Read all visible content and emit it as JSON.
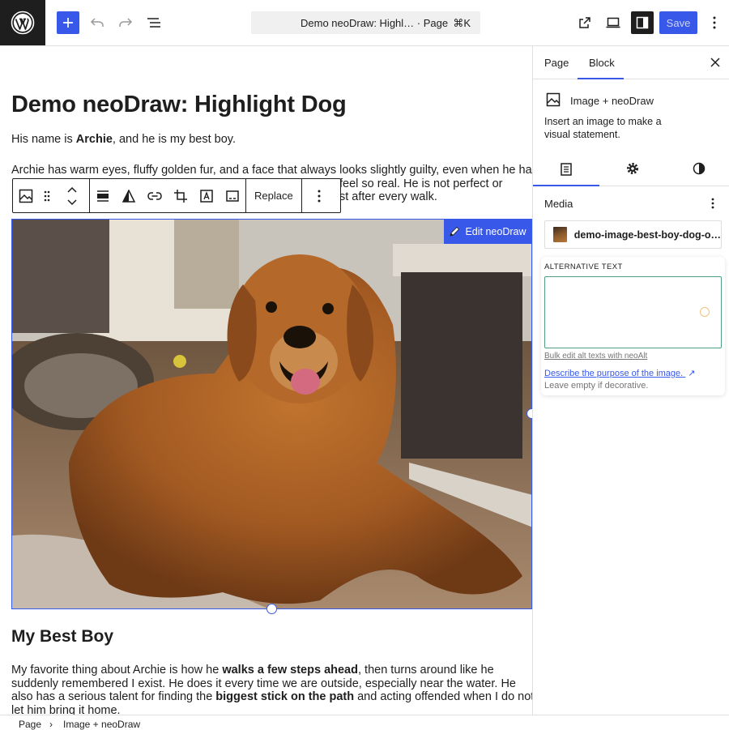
{
  "header": {
    "document_title": "Demo neoDraw: Highl… · Page",
    "shortcut": "⌘K",
    "save_label": "Save"
  },
  "colors": {
    "accent": "#3858e9",
    "dark": "#1e1e1e",
    "alt_focus": "#4f9d83"
  },
  "icons": [
    "wordpress-logo-icon",
    "plus-icon",
    "undo-icon",
    "redo-icon",
    "document-overview-icon",
    "external-link-icon",
    "device-preview-icon",
    "sidebar-toggle-icon",
    "more-vertical-icon"
  ],
  "content": {
    "title": "Demo neoDraw: Highlight Dog",
    "p1_a": "His name is ",
    "p1_b": "Archie",
    "p1_c": ", and he is my best boy.",
    "p2_line1": "Archie has warm eyes, fluffy golden fur, and a face that always looks slightly guilty, even when he has",
    "p2_line2_tail": "feel so real. He is not perfect or",
    "p2_line3_tail": "st after every walk.",
    "heading2": "My Best Boy",
    "p3_a": "My favorite thing about Archie is how he ",
    "p3_b": "walks a few steps ahead",
    "p3_c": ", then turns around like he suddenly remembered I exist. He does it every time we are outside, especially near the water. He also has a serious talent for finding the ",
    "p3_d": "biggest stick on the path",
    "p3_e": " and acting offended when I do not let him bring it home."
  },
  "block_toolbar": {
    "replace_label": "Replace"
  },
  "image_block": {
    "edit_label": "Edit neoDraw"
  },
  "sidebar": {
    "tab_page": "Page",
    "tab_block": "Block",
    "block_name": "Image + neoDraw",
    "block_description": "Insert an image to make a visual statement.",
    "media_label": "Media",
    "media_filename": "demo-image-best-boy-dog-o…",
    "alt_text_label": "ALTERNATIVE TEXT",
    "alt_text_value": "",
    "bulk_edit_link": "Bulk edit alt texts with neoAlt",
    "describe_link": "Describe the purpose of the image.",
    "describe_link_arrow": "↗",
    "decorative_hint": "Leave empty if decorative."
  },
  "footer": {
    "crumb_1": "Page",
    "crumb_separator": "›",
    "crumb_2": "Image + neoDraw"
  }
}
